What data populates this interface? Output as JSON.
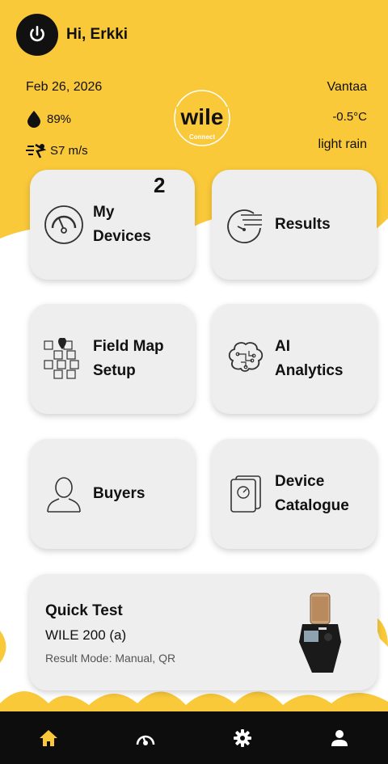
{
  "header": {
    "greeting": "Hi, Erkki",
    "date": "Feb 26, 2026",
    "humidity": "89%",
    "wind": "S7 m/s",
    "city": "Vantaa",
    "temperature": "-0.5°C",
    "condition": "light rain",
    "logo_text": "wile",
    "logo_sub": "Connect"
  },
  "tiles": [
    {
      "label_line1": "My",
      "label_line2": "Devices",
      "badge": "2",
      "icon": "gauge-icon"
    },
    {
      "label_line1": "Results",
      "icon": "results-clock-icon"
    },
    {
      "label_line1": "Field Map",
      "label_line2": "Setup",
      "icon": "field-map-icon"
    },
    {
      "label_line1": "AI",
      "label_line2": "Analytics",
      "icon": "brain-icon"
    },
    {
      "label_line1": "Buyers",
      "icon": "person-icon"
    },
    {
      "label_line1": "Device",
      "label_line2": "Catalogue",
      "icon": "device-catalogue-icon"
    }
  ],
  "quick_test": {
    "title": "Quick Test",
    "model": "WILE 200 (a)",
    "mode": "Result Mode: Manual, QR"
  },
  "nav": [
    "home-icon",
    "gauge-nav-icon",
    "settings-icon",
    "profile-icon"
  ],
  "colors": {
    "brand_yellow": "#f9c93a",
    "nav_bg": "#0d0d0d",
    "card_bg": "#eeeeee"
  }
}
